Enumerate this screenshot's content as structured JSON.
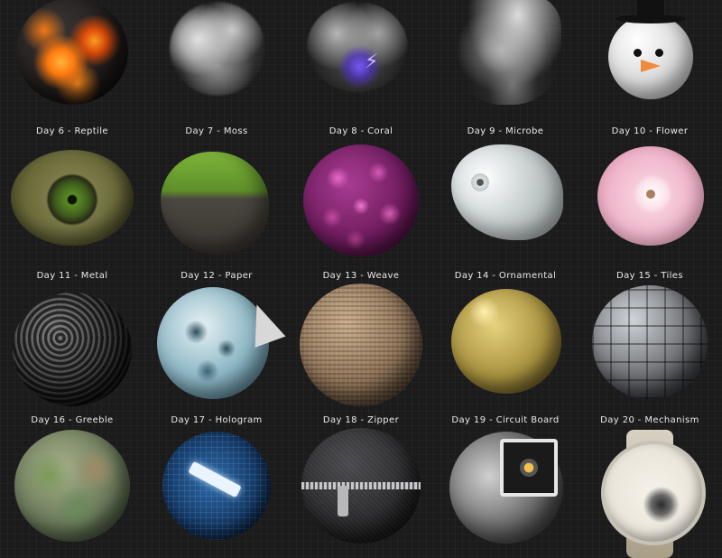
{
  "rows": [
    {
      "days": [
        {
          "label": "",
          "art": "lava-sphere",
          "colors": [
            "#2a2625",
            "#ff8a1e",
            "#c63a08"
          ]
        },
        {
          "label": "",
          "art": "smoke-cloud",
          "colors": [
            "#8a8a8a",
            "#d9d9d9",
            "#3a3a3a"
          ]
        },
        {
          "label": "",
          "art": "storm-cloud",
          "colors": [
            "#6a6a6a",
            "#5a3fd8",
            "#2b2b2b"
          ]
        },
        {
          "label": "",
          "art": "tornado",
          "colors": [
            "#a8a8a8",
            "#e0e0e0",
            "#2a2a2a"
          ]
        },
        {
          "label": "",
          "art": "snowman-head",
          "colors": [
            "#e8e8e8",
            "#111111",
            "#f08a3c"
          ]
        }
      ]
    },
    {
      "days": [
        {
          "label": "Day 6 - Reptile",
          "art": "reptile-eye",
          "colors": [
            "#7c7f4a",
            "#3d5a1e",
            "#a6a66a"
          ]
        },
        {
          "label": "Day 7 - Moss",
          "art": "moss-rock",
          "colors": [
            "#5e8f2a",
            "#4a4640",
            "#8fc24a"
          ]
        },
        {
          "label": "Day 8 - Coral",
          "art": "coral-ball",
          "colors": [
            "#8a2a7a",
            "#c24aa0",
            "#3a0a2a"
          ]
        },
        {
          "label": "Day 9 - Microbe",
          "art": "tardigrade",
          "colors": [
            "#c9cfcf",
            "#8f9797",
            "#eef2f2"
          ]
        },
        {
          "label": "Day 10 - Flower",
          "art": "rose-flower",
          "colors": [
            "#f4c6d6",
            "#ffffff",
            "#d88aa6"
          ]
        }
      ]
    },
    {
      "days": [
        {
          "label": "Day 11 - Metal",
          "art": "bolt-cluster",
          "colors": [
            "#4a4a4a",
            "#9a9a9a",
            "#1a1a1a"
          ]
        },
        {
          "label": "Day 12 - Paper",
          "art": "paper-sphere",
          "colors": [
            "#4f7f93",
            "#cfe3ea",
            "#2b4d5c"
          ]
        },
        {
          "label": "Day 13 - Weave",
          "art": "woven-sphere",
          "colors": [
            "#8a6e52",
            "#c2a986",
            "#4a3826"
          ]
        },
        {
          "label": "Day 14 - Ornamental",
          "art": "golden-snitch",
          "colors": [
            "#a7913f",
            "#e0cc7a",
            "#5c4d1e"
          ]
        },
        {
          "label": "Day 15 - Tiles",
          "art": "tile-sphere",
          "colors": [
            "#6a6c70",
            "#b0b4b8",
            "#2a2c30"
          ]
        }
      ]
    },
    {
      "days": [
        {
          "label": "Day 16 - Greeble",
          "art": "terrain-planet",
          "colors": [
            "#6a8a5a",
            "#a08a66",
            "#3a5a6a"
          ]
        },
        {
          "label": "Day 17 - Hologram",
          "art": "hologram-bolt",
          "colors": [
            "#1f4a78",
            "#cfe8ff",
            "#0a1a33"
          ]
        },
        {
          "label": "Day 18 - Zipper",
          "art": "zipper-ball",
          "colors": [
            "#2a2a2c",
            "#b8b8bc",
            "#111113"
          ]
        },
        {
          "label": "Day 19 - Circuit Board",
          "art": "fan-sphere",
          "colors": [
            "#3a4a2e",
            "#d9d9d9",
            "#1a1a1a"
          ]
        },
        {
          "label": "Day 20 - Mechanism",
          "art": "wristwatch",
          "colors": [
            "#e9e4da",
            "#8a7a5a",
            "#2a2a2a"
          ]
        }
      ]
    }
  ]
}
